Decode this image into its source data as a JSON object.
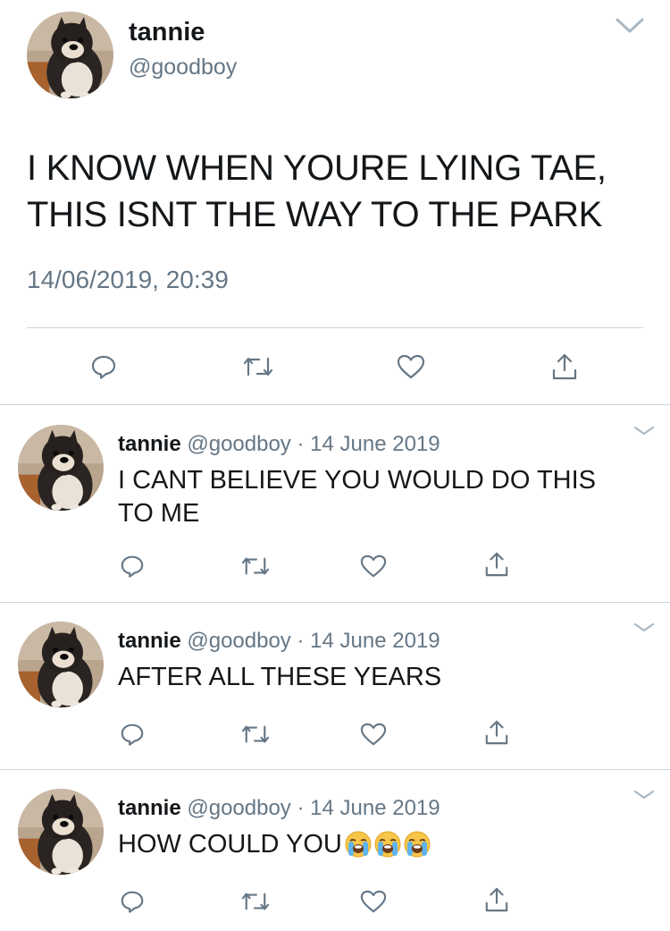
{
  "main_tweet": {
    "name": "tannie",
    "handle": "@goodboy",
    "text_lines": [
      "I KNOW WHEN YOURE LYING TAE,",
      "THIS ISNT THE WAY TO THE PARK"
    ],
    "timestamp": "14/06/2019, 20:39",
    "actions": [
      "reply-icon",
      "retweet-icon",
      "like-icon",
      "share-icon"
    ]
  },
  "replies": [
    {
      "name": "tannie",
      "handle": "@goodboy",
      "separator": "·",
      "date": "14 June 2019",
      "text_lines": [
        "I CANT BELIEVE YOU WOULD DO THIS",
        "TO ME"
      ],
      "emojis": []
    },
    {
      "name": "tannie",
      "handle": "@goodboy",
      "separator": "·",
      "date": "14 June 2019",
      "text_lines": [
        "AFTER ALL THESE YEARS"
      ],
      "emojis": []
    },
    {
      "name": "tannie",
      "handle": "@goodboy",
      "separator": "·",
      "date": "14 June 2019",
      "text_lines": [
        "HOW COULD YOU"
      ],
      "emojis": [
        "loudly-crying-face-emoji",
        "loudly-crying-face-emoji",
        "loudly-crying-face-emoji"
      ]
    }
  ],
  "colors": {
    "text": "#14171a",
    "secondary": "#657786",
    "divider": "#ccd6dd",
    "icon": "#657786"
  }
}
